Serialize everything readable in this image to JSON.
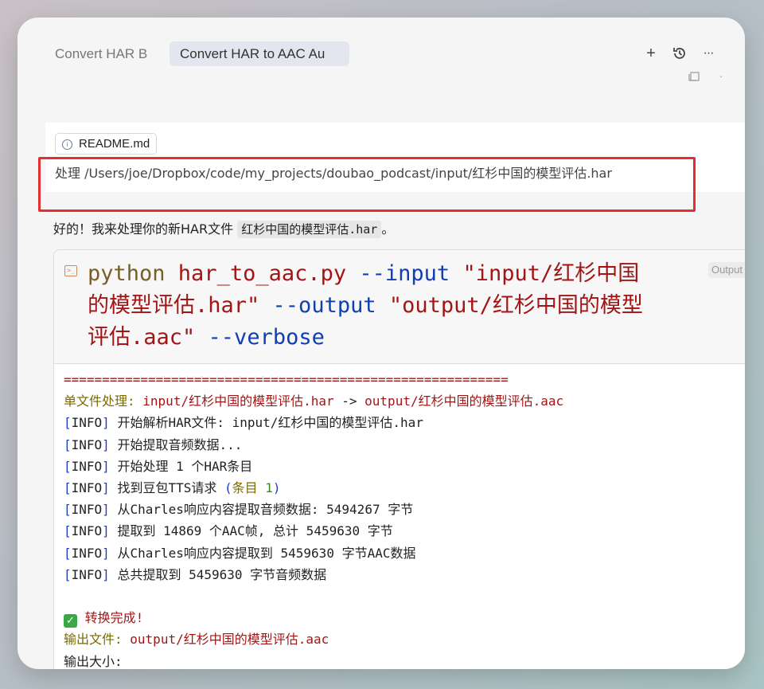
{
  "tabs": [
    {
      "label": "Convert HAR B",
      "active": false
    },
    {
      "label": "Convert HAR to AAC Au",
      "active": true
    }
  ],
  "toolbar": {
    "icons": [
      "plus-icon",
      "history-icon",
      "more-icon"
    ],
    "plus": "+",
    "more": "···"
  },
  "message": {
    "attachment": "README.md",
    "text": "处理 /Users/joe/Dropbox/code/my_projects/doubao_podcast/input/红杉中国的模型评估.har"
  },
  "reply": {
    "prefix": "好的！我来处理你的新HAR文件 ",
    "file": "红杉中国的模型评估.har",
    "suffix": "。"
  },
  "command": {
    "kw": "python",
    "script": " har_to_aac.py ",
    "flag_input": "--input",
    "input_val": " \"input/红杉中国的模型评估.har\" ",
    "flag_output": "--output",
    "output_val": " \"output/红杉中国的模型评估.aac\" ",
    "flag_verbose": "--verbose",
    "badge": "Output"
  },
  "output": {
    "separator": "==========================================================",
    "single_label": "单文件处理: ",
    "single_in": "input/红杉中国的模型评估.har",
    "arrow": " -> ",
    "single_out": "output/红杉中国的模型评估.aac",
    "info_tag": "INFO",
    "info_lines": [
      "开始解析HAR文件: input/红杉中国的模型评估.har",
      "开始提取音频数据...",
      "开始处理 1 个HAR条目"
    ],
    "tts_prefix": "找到豆包TTS请求 ",
    "tts_paren_open": "(",
    "tts_item": "条目 ",
    "tts_num": "1",
    "tts_paren_close": ")",
    "info_lines2": [
      "从Charles响应内容提取音频数据: 5494267 字节",
      "提取到 14869 个AAC帧, 总计 5459630 字节",
      "从Charles响应内容提取到 5459630 字节AAC数据",
      "总共提取到 5459630 字节音频数据"
    ],
    "done": "转换完成!",
    "out_file_label": "输出文件: ",
    "out_file": "output/红杉中国的模型评估.aac",
    "partial_line": "输出大小: "
  }
}
